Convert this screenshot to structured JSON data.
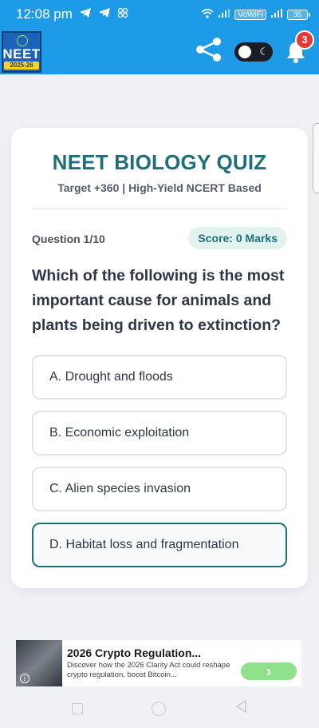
{
  "status_bar": {
    "time": "12:08 pm",
    "volte_label": "VoWiFi",
    "battery": "35",
    "icons": [
      "telegram-icon",
      "telegram-icon",
      "usb-icon",
      "wifi-icon",
      "signal-icon",
      "signal-icon",
      "battery-icon"
    ]
  },
  "app_bar": {
    "logo_text": "NEET",
    "logo_year": "2025-26",
    "notification_count": "3",
    "theme_toggle_icon": "moon-icon"
  },
  "quiz": {
    "title": "NEET BIOLOGY QUIZ",
    "subtitle": "Target +360 | High-Yield NCERT Based",
    "question_number": "Question 1/10",
    "score": "Score: 0 Marks",
    "question": "Which of the following is the most important cause for animals and plants being driven to extinction?",
    "options": [
      {
        "label": "A. Drought and floods"
      },
      {
        "label": "B. Economic exploitation"
      },
      {
        "label": "C. Alien species invasion"
      },
      {
        "label": "D. Habitat loss and fragmentation"
      }
    ]
  },
  "ad": {
    "title": "2026 Crypto Regulation...",
    "description": "Discover how the 2026 Clarity Act could reshape crypto regulation, boost Bitcoin...",
    "cta_icon": "chevron-right-icon",
    "info_icon": "info-icon"
  },
  "colors": {
    "primary": "#1e9be6",
    "accent": "#1f6f7a",
    "badge": "#e53935",
    "cta": "#8ee08a"
  }
}
